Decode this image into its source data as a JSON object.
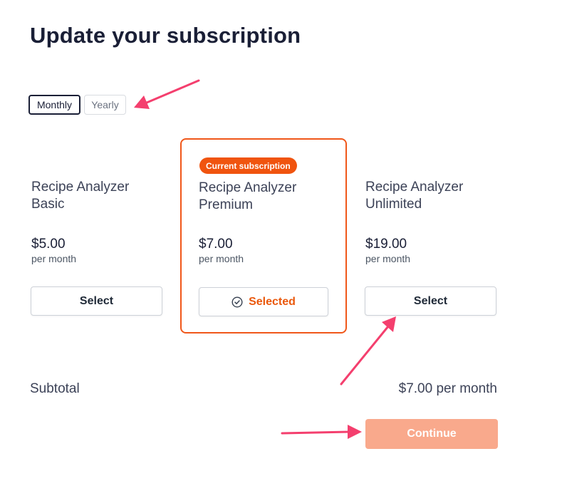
{
  "page": {
    "title": "Update your subscription"
  },
  "billing_toggle": {
    "monthly": "Monthly",
    "yearly": "Yearly",
    "selected": "Monthly"
  },
  "plans": [
    {
      "name_line1": "Recipe Analyzer",
      "name_line2": "Basic",
      "price": "$5.00",
      "period": "per month",
      "button": "Select"
    },
    {
      "name_line1": "Recipe Analyzer",
      "name_line2": "Premium",
      "price": "$7.00",
      "period": "per month",
      "button": "Selected",
      "badge": "Current subscription"
    },
    {
      "name_line1": "Recipe Analyzer",
      "name_line2": "Unlimited",
      "price": "$19.00",
      "period": "per month",
      "button": "Select"
    }
  ],
  "subtotal": {
    "label": "Subtotal",
    "value": "$7.00 per month"
  },
  "continue_button": "Continue",
  "colors": {
    "accent": "#f0571a",
    "continue_bg": "#f9a98c",
    "annotation_arrow": "#f43f6e"
  }
}
